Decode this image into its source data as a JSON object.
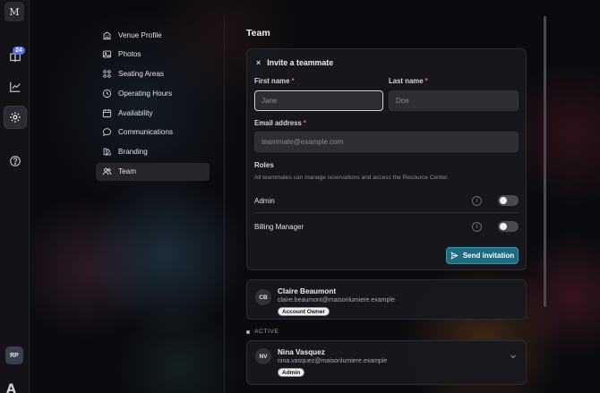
{
  "rail": {
    "logo": "M",
    "badge": "24",
    "avatar": "RP",
    "brand": "A",
    "icons": [
      "book-icon",
      "chart-icon",
      "gear-icon",
      "help-icon"
    ]
  },
  "nav": {
    "items": [
      {
        "label": "Venue Profile",
        "icon": "building-icon"
      },
      {
        "label": "Photos",
        "icon": "image-icon"
      },
      {
        "label": "Seating Areas",
        "icon": "grid-icon"
      },
      {
        "label": "Operating Hours",
        "icon": "clock-icon"
      },
      {
        "label": "Availability",
        "icon": "calendar-icon"
      },
      {
        "label": "Communications",
        "icon": "message-icon"
      },
      {
        "label": "Branding",
        "icon": "palette-icon"
      },
      {
        "label": "Team",
        "icon": "users-icon"
      }
    ],
    "active": "Team"
  },
  "page": {
    "title": "Team"
  },
  "invite": {
    "close_glyph": "×",
    "title": "Invite a teammate",
    "first_name_label": "First name",
    "first_name_placeholder": "Jane",
    "last_name_label": "Last name",
    "last_name_placeholder": "Doe",
    "email_label": "Email address",
    "email_placeholder": "teammate@example.com",
    "required_mark": "*",
    "roles_title": "Roles",
    "roles_desc": "All teammates can manage reservations and access the Resource Center.",
    "roles": [
      {
        "name": "Admin",
        "enabled": false
      },
      {
        "name": "Billing Manager",
        "enabled": false
      }
    ],
    "info_glyph": "i",
    "send_label": "Send invitation"
  },
  "owner": {
    "initials": "CB",
    "name": "Claire Beaumont",
    "email": "claire.beaumont@maisonlumiere.example",
    "badge": "Account Owner"
  },
  "active_section": {
    "label": "ACTIVE",
    "members": [
      {
        "initials": "NV",
        "name": "Nina Vasquez",
        "email": "nina.vasquez@maisonlumiere.example",
        "badge": "Admin"
      }
    ]
  },
  "colors": {
    "accent_button": "#1f6a80",
    "required": "#e06a6a",
    "badge": "#5b6ee8"
  }
}
